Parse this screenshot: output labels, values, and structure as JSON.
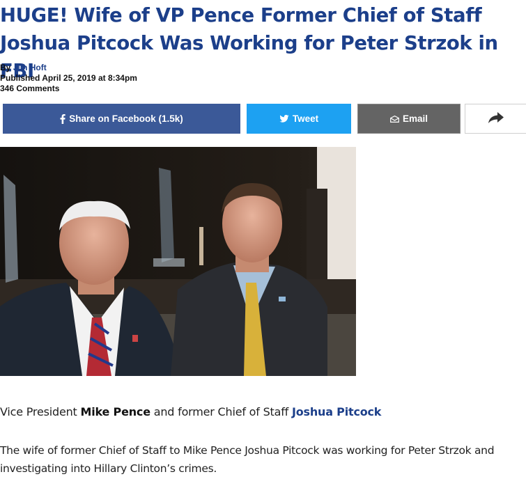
{
  "article": {
    "headline": "HUGE! Wife of VP Pence Former Chief of Staff Joshua Pitcock Was Working for Peter Strzok in FBI",
    "by_label": "By ",
    "author": "Jim Hoft",
    "published": "Published April 25, 2019 at 8:34pm",
    "comments": "346 Comments"
  },
  "share": {
    "facebook_label": "Share on Facebook (1.5k)",
    "tweet_label": "Tweet",
    "email_label": "Email",
    "icons": [
      "facebook-icon",
      "twitter-bird-icon",
      "envelope-icon",
      "share-arrow-icon"
    ],
    "colors": {
      "facebook": "#3b5998",
      "twitter": "#1da1f2",
      "email": "#646464"
    }
  },
  "caption": {
    "prefix": "Vice President ",
    "person1": "Mike Pence",
    "middle": " and former Chief of Staff ",
    "person2": "Joshua Pitcock"
  },
  "body": {
    "paragraph1": "The wife of former Chief of Staff to Mike Pence Joshua Pitcock was working for Peter Strzok and investigating into Hillary Clinton’s crimes."
  },
  "colors": {
    "link": "#1c3f8a"
  }
}
